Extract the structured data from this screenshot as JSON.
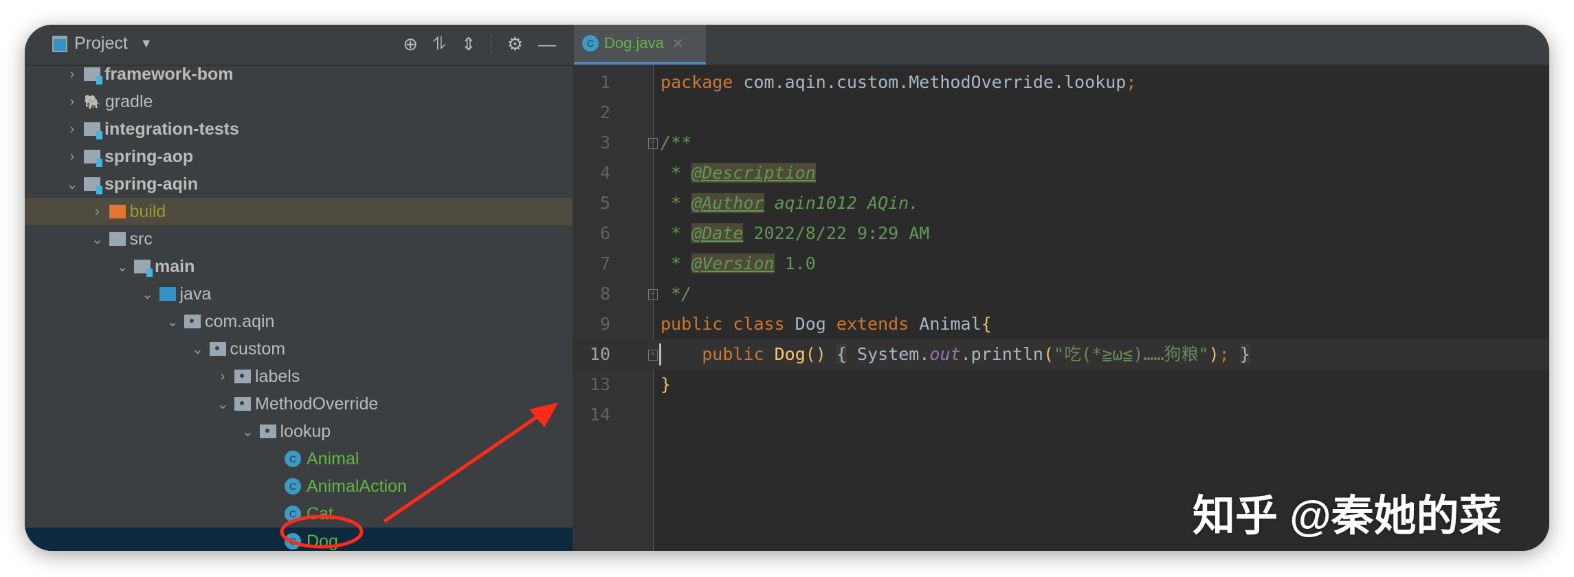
{
  "project_panel": {
    "title": "Project",
    "tools": [
      "locate-icon",
      "expand-all-icon",
      "collapse-all-icon",
      "gear-icon",
      "minimize-icon"
    ],
    "tree": [
      {
        "label": "framework-bom",
        "level": 0,
        "arrow": "›",
        "icon": "module",
        "bold": true
      },
      {
        "label": "gradle",
        "level": 0,
        "arrow": "›",
        "icon": "gradle"
      },
      {
        "label": "integration-tests",
        "level": 0,
        "arrow": "›",
        "icon": "module",
        "bold": true
      },
      {
        "label": "spring-aop",
        "level": 0,
        "arrow": "›",
        "icon": "module",
        "bold": true
      },
      {
        "label": "spring-aqin",
        "level": 0,
        "arrow": "⌄",
        "icon": "module",
        "bold": true
      },
      {
        "label": "build",
        "level": 1,
        "arrow": "›",
        "icon": "build",
        "state": "excluded"
      },
      {
        "label": "src",
        "level": 1,
        "arrow": "⌄",
        "icon": "folder"
      },
      {
        "label": "main",
        "level": 2,
        "arrow": "⌄",
        "icon": "module",
        "bold": true
      },
      {
        "label": "java",
        "level": 3,
        "arrow": "⌄",
        "icon": "source"
      },
      {
        "label": "com.aqin",
        "level": 4,
        "arrow": "⌄",
        "icon": "package"
      },
      {
        "label": "custom",
        "level": 5,
        "arrow": "⌄",
        "icon": "package"
      },
      {
        "label": "labels",
        "level": 6,
        "arrow": "›",
        "icon": "package"
      },
      {
        "label": "MethodOverride",
        "level": 6,
        "arrow": "⌄",
        "icon": "package"
      },
      {
        "label": "lookup",
        "level": 7,
        "arrow": "⌄",
        "icon": "package"
      },
      {
        "label": "Animal",
        "level": 8,
        "arrow": "",
        "icon": "class",
        "modified": true
      },
      {
        "label": "AnimalAction",
        "level": 8,
        "arrow": "",
        "icon": "abstract-class",
        "modified": true
      },
      {
        "label": "Cat",
        "level": 8,
        "arrow": "",
        "icon": "class",
        "modified": true
      },
      {
        "label": "Dog",
        "level": 8,
        "arrow": "",
        "icon": "class",
        "modified": true,
        "selected": true
      }
    ]
  },
  "editor": {
    "tab": {
      "label": "Dog.java",
      "icon": "C"
    },
    "current_line": "10",
    "lines": [
      {
        "n": "1",
        "html": "<span class='kw'>package</span> com.aqin.custom.MethodOverride.lookup<span class='kw'>;</span>"
      },
      {
        "n": "2",
        "html": ""
      },
      {
        "n": "3",
        "html": "<span class='doc'>/**</span>"
      },
      {
        "n": "4",
        "html": "<span class='doc'> * </span><span class='tag'>@Description</span>"
      },
      {
        "n": "5",
        "html": "<span class='doc'> * </span><span class='tag'>@Author</span><span class='doc'> aqin1012 AQin.</span>"
      },
      {
        "n": "6",
        "html": "<span class='doc'> * </span><span class='tag'>@Date</span><span class='doc' style='font-style:normal'> 2022/8/22 9:29 AM</span>"
      },
      {
        "n": "7",
        "html": "<span class='doc'> * </span><span class='tag'>@Version</span><span class='doc' style='font-style:normal'> 1.0</span>"
      },
      {
        "n": "8",
        "html": "<span class='doc'> */</span>"
      },
      {
        "n": "9",
        "html": "<span class='kw'>public class</span> Dog <span class='kw'>extends</span> Animal<span class='br'>{</span>"
      },
      {
        "n": "10",
        "html": "    <span class='kw'>public</span> <span class='fn'>Dog</span><span class='br'>()</span> <span class='fold'>{</span> System.<span class='fld'>out</span>.println<span class='br'>(</span><span class='str'>\"吃(*≧ω≦)……狗粮\"</span><span class='br'>)</span><span class='kw'>;</span> <span class='fold'>}</span>"
      },
      {
        "n": "13",
        "html": "<span class='br'>}</span>"
      },
      {
        "n": "14",
        "html": ""
      }
    ]
  },
  "watermark": "知乎 @秦她的菜",
  "colors": {
    "annotation": "#ff2a1a",
    "selection": "#0d293e",
    "accent": "#4a88c7"
  }
}
